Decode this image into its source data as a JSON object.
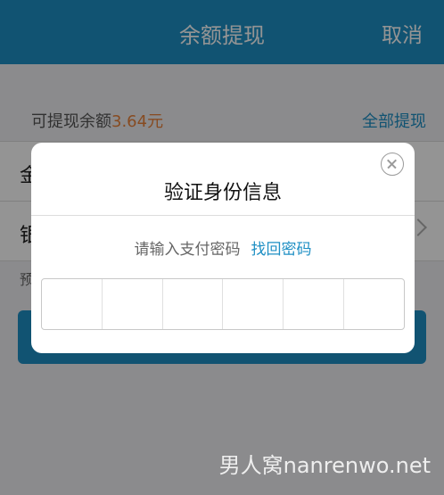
{
  "navbar": {
    "title": "余额提现",
    "cancel_label": "取消"
  },
  "balance": {
    "label": "可提现余额",
    "amount": "3.64元",
    "withdraw_all_label": "全部提现"
  },
  "form": {
    "amount_row_label": "金",
    "bank_row_label": "银",
    "estimate_text": "预"
  },
  "modal": {
    "title": "验证身份信息",
    "prompt": "请输入支付密码",
    "forgot_link": "找回密码",
    "pin_digits": 6
  },
  "watermark": {
    "text": "男人窝nanrenwo.net"
  },
  "colors": {
    "accent": "#1e8fc4",
    "amount": "#e8823a"
  }
}
